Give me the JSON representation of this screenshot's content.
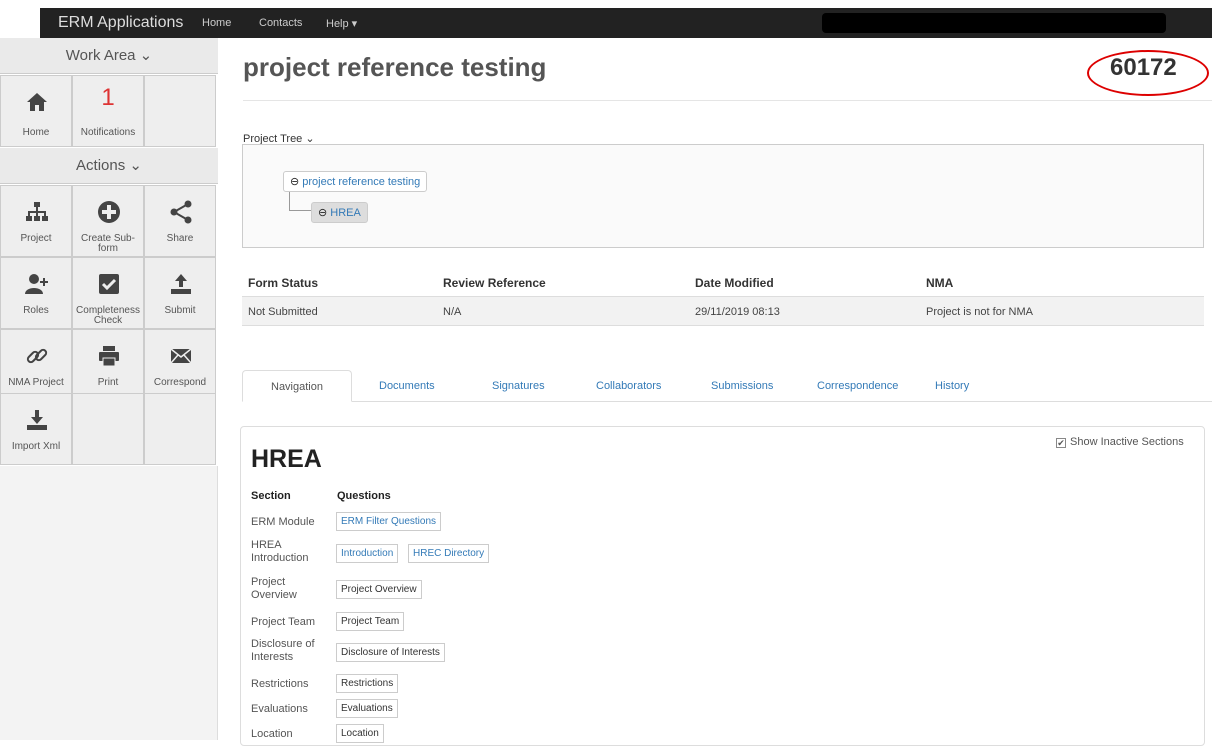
{
  "topbar": {
    "brand": "ERM Applications",
    "links": [
      "Home",
      "Contacts",
      "Help ▾"
    ]
  },
  "sidebar": {
    "work_area": "Work Area ⌄",
    "actions": "Actions ⌄",
    "home_label": "Home",
    "notifications_count": "1",
    "notifications_label": "Notifications",
    "project_label": "Project",
    "create_subform_label": "Create Sub-form",
    "share_label": "Share",
    "roles_label": "Roles",
    "completeness_label": "Completeness Check",
    "submit_label": "Submit",
    "nma_label": "NMA Project",
    "print_label": "Print",
    "correspond_label": "Correspond",
    "import_label": "Import Xml"
  },
  "page": {
    "title": "project reference testing",
    "project_id": "60172"
  },
  "tree": {
    "label": "Project Tree ⌄",
    "root": "project reference testing",
    "child": "HREA"
  },
  "grid": {
    "headers": [
      "Form Status",
      "Review Reference",
      "Date Modified",
      "NMA"
    ],
    "values": [
      "Not Submitted",
      "N/A",
      "29/11/2019 08:13",
      "Project is not for NMA"
    ]
  },
  "tabs": [
    "Navigation",
    "Documents",
    "Signatures",
    "Collaborators",
    "Submissions",
    "Correspondence",
    "History"
  ],
  "panel": {
    "show_inactive": "Show Inactive Sections",
    "title": "HREA",
    "section_header": "Section",
    "questions_header": "Questions",
    "sections": [
      {
        "name": "ERM Module",
        "questions": [
          "ERM Filter Questions"
        ]
      },
      {
        "name": "HREA Introduction",
        "questions": [
          "Introduction",
          "HREC Directory"
        ]
      },
      {
        "name": "Project Overview",
        "questions": [
          "Project Overview"
        ]
      },
      {
        "name": "Project Team",
        "questions": [
          "Project Team"
        ]
      },
      {
        "name": "Disclosure of Interests",
        "questions": [
          "Disclosure of Interests"
        ]
      },
      {
        "name": "Restrictions",
        "questions": [
          "Restrictions"
        ]
      },
      {
        "name": "Evaluations",
        "questions": [
          "Evaluations"
        ]
      },
      {
        "name": "Location",
        "questions": [
          "Location"
        ]
      }
    ]
  }
}
